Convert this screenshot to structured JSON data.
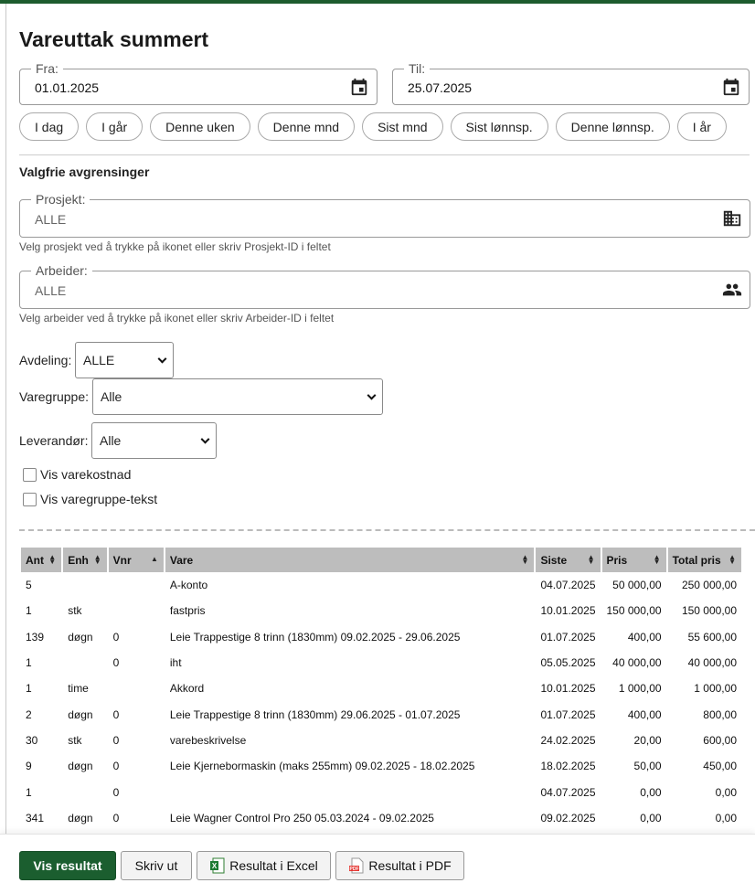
{
  "page": {
    "title": "Vareuttak summert"
  },
  "date_range": {
    "from_label": "Fra:",
    "from_value": "01.01.2025",
    "to_label": "Til:",
    "to_value": "25.07.2025"
  },
  "quick_ranges": [
    "I dag",
    "I går",
    "Denne uken",
    "Denne mnd",
    "Sist mnd",
    "Sist lønnsp.",
    "Denne lønnsp.",
    "I år"
  ],
  "filters": {
    "heading": "Valgfrie avgrensinger",
    "project": {
      "label": "Prosjekt:",
      "value": "ALLE",
      "help": "Velg prosjekt ved å trykke på ikonet eller skriv Prosjekt-ID i feltet",
      "icon": "building-icon"
    },
    "worker": {
      "label": "Arbeider:",
      "value": "ALLE",
      "help": "Velg arbeider ved å trykke på ikonet eller skriv Arbeider-ID i feltet",
      "icon": "people-icon"
    },
    "department": {
      "label": "Avdeling:",
      "value": "ALLE"
    },
    "product_group": {
      "label": "Varegruppe:",
      "value": "Alle"
    },
    "supplier": {
      "label": "Leverandør:",
      "value": "Alle"
    },
    "show_cost": {
      "label": "Vis varekostnad",
      "checked": false
    },
    "show_group_text": {
      "label": "Vis varegruppe-tekst",
      "checked": false
    }
  },
  "table": {
    "headers": [
      "Ant",
      "Enh",
      "Vnr",
      "Vare",
      "Siste",
      "Pris",
      "Total pris"
    ],
    "rows": [
      [
        "5",
        "",
        "",
        "A-konto",
        "04.07.2025",
        "50 000,00",
        "250 000,00"
      ],
      [
        "1",
        "stk",
        "",
        "fastpris",
        "10.01.2025",
        "150 000,00",
        "150 000,00"
      ],
      [
        "139",
        "døgn",
        "0",
        "Leie Trappestige 8 trinn (1830mm) 09.02.2025 - 29.06.2025",
        "01.07.2025",
        "400,00",
        "55 600,00"
      ],
      [
        "1",
        "",
        "0",
        "iht",
        "05.05.2025",
        "40 000,00",
        "40 000,00"
      ],
      [
        "1",
        "time",
        "",
        "Akkord",
        "10.01.2025",
        "1 000,00",
        "1 000,00"
      ],
      [
        "2",
        "døgn",
        "0",
        "Leie Trappestige 8 trinn (1830mm) 29.06.2025 - 01.07.2025",
        "01.07.2025",
        "400,00",
        "800,00"
      ],
      [
        "30",
        "stk",
        "0",
        "varebeskrivelse",
        "24.02.2025",
        "20,00",
        "600,00"
      ],
      [
        "9",
        "døgn",
        "0",
        "Leie Kjernebormaskin (maks 255mm) 09.02.2025 - 18.02.2025",
        "18.02.2025",
        "50,00",
        "450,00"
      ],
      [
        "1",
        "",
        "0",
        "",
        "04.07.2025",
        "0,00",
        "0,00"
      ],
      [
        "341",
        "døgn",
        "0",
        "Leie Wagner Control Pro 250 05.03.2024 - 09.02.2025",
        "09.02.2025",
        "0,00",
        "0,00"
      ]
    ]
  },
  "actions": {
    "show_result": "Vis resultat",
    "print": "Skriv ut",
    "excel": "Resultat i Excel",
    "pdf": "Resultat i PDF"
  },
  "colors": {
    "primary": "#1b5e2f",
    "header_bg": "#bdbdbd"
  }
}
